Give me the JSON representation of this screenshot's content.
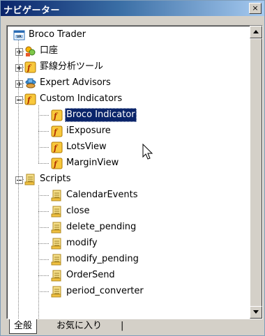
{
  "window": {
    "title": "ナビゲーター",
    "close_glyph": "×"
  },
  "tree": {
    "root": {
      "label": "Broco Trader",
      "icon": "terminal-icon"
    },
    "items": [
      {
        "label": "口座",
        "icon": "accounts-icon",
        "toggle": "+",
        "level": 1
      },
      {
        "label": "罫線分析ツール",
        "icon": "indicator-icon",
        "toggle": "+",
        "level": 1
      },
      {
        "label": "Expert Advisors",
        "icon": "expert-icon",
        "toggle": "+",
        "level": 1
      },
      {
        "label": "Custom Indicators",
        "icon": "indicator-icon",
        "toggle": "-",
        "level": 1
      },
      {
        "label": "Broco Indicator",
        "icon": "indicator-icon",
        "level": 2,
        "selected": true
      },
      {
        "label": "iExposure",
        "icon": "indicator-icon",
        "level": 2
      },
      {
        "label": "LotsView",
        "icon": "indicator-icon",
        "level": 2
      },
      {
        "label": "MarginView",
        "icon": "indicator-icon",
        "level": 2
      },
      {
        "label": "Scripts",
        "icon": "script-icon",
        "toggle": "-",
        "level": 1
      },
      {
        "label": "CalendarEvents",
        "icon": "script-icon",
        "level": 2
      },
      {
        "label": "close",
        "icon": "script-icon",
        "level": 2
      },
      {
        "label": "delete_pending",
        "icon": "script-icon",
        "level": 2
      },
      {
        "label": "modify",
        "icon": "script-icon",
        "level": 2
      },
      {
        "label": "modify_pending",
        "icon": "script-icon",
        "level": 2
      },
      {
        "label": "OrderSend",
        "icon": "script-icon",
        "level": 2
      },
      {
        "label": "period_converter",
        "icon": "script-icon",
        "level": 2
      }
    ]
  },
  "tabs": {
    "active": "全般",
    "favorites": "お気に入り",
    "separator": "|"
  },
  "colors": {
    "selection": "#0a246a",
    "titlebar": "#0a246a",
    "panel": "#d4d0c8"
  }
}
